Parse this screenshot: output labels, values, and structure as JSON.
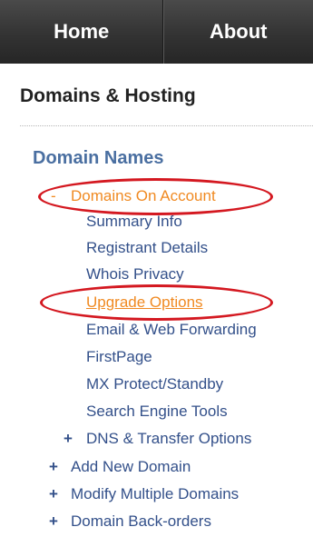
{
  "topnav": {
    "home_label": "Home",
    "about_label": "About"
  },
  "panel": {
    "section_title": "Domains & Hosting",
    "group_title": "Domain Names",
    "active_item": {
      "prefix": "-",
      "label": "Domains On Account",
      "color": "#f08a22"
    },
    "sub_items": [
      {
        "label": "Summary Info"
      },
      {
        "label": "Registrant Details"
      },
      {
        "label": "Whois Privacy"
      },
      {
        "label": "Upgrade Options",
        "highlighted": true
      },
      {
        "label": "Email & Web Forwarding"
      },
      {
        "label": "FirstPage"
      },
      {
        "label": "MX Protect/Standby"
      },
      {
        "label": "Search Engine Tools"
      }
    ],
    "dns_item": {
      "prefix": "+",
      "label": "DNS & Transfer Options"
    },
    "top_items": [
      {
        "prefix": "+",
        "label": "Add New Domain"
      },
      {
        "prefix": "+",
        "label": "Modify Multiple Domains"
      },
      {
        "prefix": "+",
        "label": "Domain Back-orders"
      }
    ],
    "link_color": "#33508a",
    "annotation_color": "#d41820"
  }
}
